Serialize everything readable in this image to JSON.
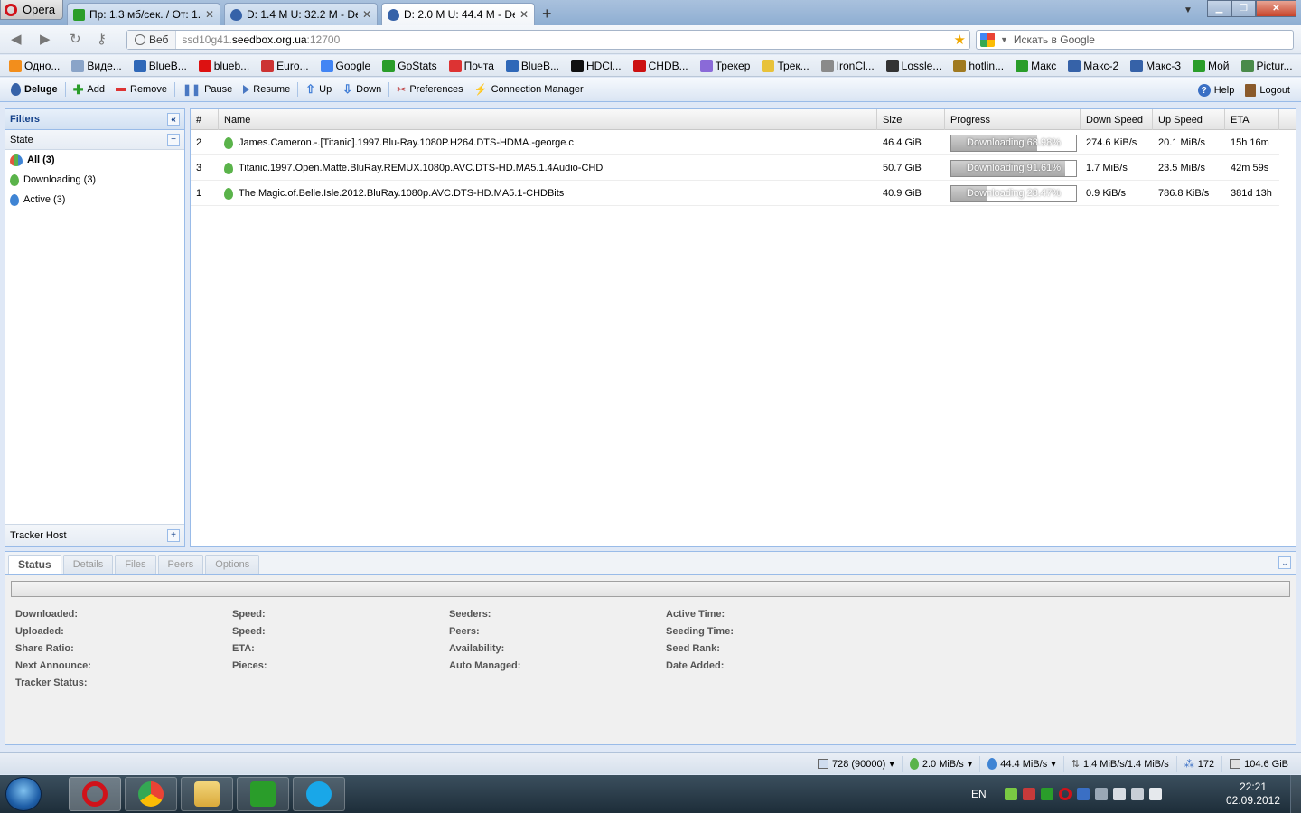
{
  "browser": {
    "menu_label": "Opera",
    "tabs": [
      {
        "label": "Пр: 1.3 мб/сек. / От: 1....",
        "close": "✕"
      },
      {
        "label": "D: 1.4 M U: 32.2 M - Del...",
        "close": "✕"
      },
      {
        "label": "D: 2.0 M U: 44.4 M - Del...",
        "close": "✕"
      }
    ],
    "new_tab": "+",
    "address": {
      "scheme_label": "Веб",
      "url_prefix": "ssd10g41.",
      "url_domain": "seedbox.org.ua",
      "url_suffix": ":12700"
    },
    "search_placeholder": "Искать в Google",
    "bookmarks": [
      {
        "label": "Одно...",
        "color": "#f28e1c"
      },
      {
        "label": "Виде...",
        "color": "#8aa4c8"
      },
      {
        "label": "BlueB...",
        "color": "#2f68b8"
      },
      {
        "label": "blueb...",
        "color": "#d11"
      },
      {
        "label": "Euro...",
        "color": "#c33"
      },
      {
        "label": "Google",
        "color": "#4285f4"
      },
      {
        "label": "GoStats",
        "color": "#2a9d2a"
      },
      {
        "label": "Почта",
        "color": "#d33"
      },
      {
        "label": "BlueB...",
        "color": "#2f68b8"
      },
      {
        "label": "HDCl...",
        "color": "#111"
      },
      {
        "label": "CHDB...",
        "color": "#c11"
      },
      {
        "label": "Трекер",
        "color": "#8a6ad8"
      },
      {
        "label": "Трек...",
        "color": "#e8c23a"
      },
      {
        "label": "IronCl...",
        "color": "#8a8a8a"
      },
      {
        "label": "Lossle...",
        "color": "#333"
      },
      {
        "label": "hotlin...",
        "color": "#a07a20"
      },
      {
        "label": "Макс",
        "color": "#2a9d2a"
      },
      {
        "label": "Макс-2",
        "color": "#3662a8"
      },
      {
        "label": "Макс-3",
        "color": "#3662a8"
      },
      {
        "label": "Мой",
        "color": "#2a9d2a"
      },
      {
        "label": "Pictur...",
        "color": "#4a8a4a"
      }
    ]
  },
  "toolbar": {
    "app_name": "Deluge",
    "add": "Add",
    "remove": "Remove",
    "pause": "Pause",
    "resume": "Resume",
    "up": "Up",
    "down": "Down",
    "preferences": "Preferences",
    "connection_manager": "Connection Manager",
    "help": "Help",
    "logout": "Logout"
  },
  "filters": {
    "title": "Filters",
    "state_label": "State",
    "items": [
      {
        "label": "All (3)"
      },
      {
        "label": "Downloading (3)"
      },
      {
        "label": "Active (3)"
      }
    ],
    "tracker_host": "Tracker Host"
  },
  "torrents": {
    "columns": [
      "#",
      "Name",
      "Size",
      "Progress",
      "Down Speed",
      "Up Speed",
      "ETA"
    ],
    "rows": [
      {
        "num": "2",
        "name": "James.Cameron.-.[Titanic].1997.Blu-Ray.1080P.H264.DTS-HDMA.-george.c",
        "size": "46.4 GiB",
        "progress_text": "Downloading 68.98%",
        "progress": 68.98,
        "down": "274.6 KiB/s",
        "up": "20.1 MiB/s",
        "eta": "15h 16m"
      },
      {
        "num": "3",
        "name": "Titanic.1997.Open.Matte.BluRay.REMUX.1080p.AVC.DTS-HD.MA5.1.4Audio-CHD",
        "size": "50.7 GiB",
        "progress_text": "Downloading 91.61%",
        "progress": 91.61,
        "down": "1.7 MiB/s",
        "up": "23.5 MiB/s",
        "eta": "42m 59s"
      },
      {
        "num": "1",
        "name": "The.Magic.of.Belle.Isle.2012.BluRay.1080p.AVC.DTS-HD.MA5.1-CHDBits",
        "size": "40.9 GiB",
        "progress_text": "Downloading 28.47%",
        "progress": 28.47,
        "down": "0.9 KiB/s",
        "up": "786.8 KiB/s",
        "eta": "381d 13h"
      }
    ]
  },
  "details": {
    "tabs": [
      "Status",
      "Details",
      "Files",
      "Peers",
      "Options"
    ],
    "labels": {
      "downloaded": "Downloaded:",
      "uploaded": "Uploaded:",
      "share_ratio": "Share Ratio:",
      "next_announce": "Next Announce:",
      "tracker_status": "Tracker Status:",
      "speed1": "Speed:",
      "speed2": "Speed:",
      "eta": "ETA:",
      "pieces": "Pieces:",
      "seeders": "Seeders:",
      "peers": "Peers:",
      "availability": "Availability:",
      "auto_managed": "Auto Managed:",
      "active_time": "Active Time:",
      "seeding_time": "Seeding Time:",
      "seed_rank": "Seed Rank:",
      "date_added": "Date Added:"
    }
  },
  "statusbar": {
    "connections": "728 (90000)",
    "download": "2.0 MiB/s",
    "upload": "44.4 MiB/s",
    "protocol": "1.4 MiB/s/1.4 MiB/s",
    "dht": "172",
    "free_space": "104.6 GiB"
  },
  "taskbar": {
    "language": "EN",
    "time": "22:21",
    "date": "02.09.2012"
  }
}
